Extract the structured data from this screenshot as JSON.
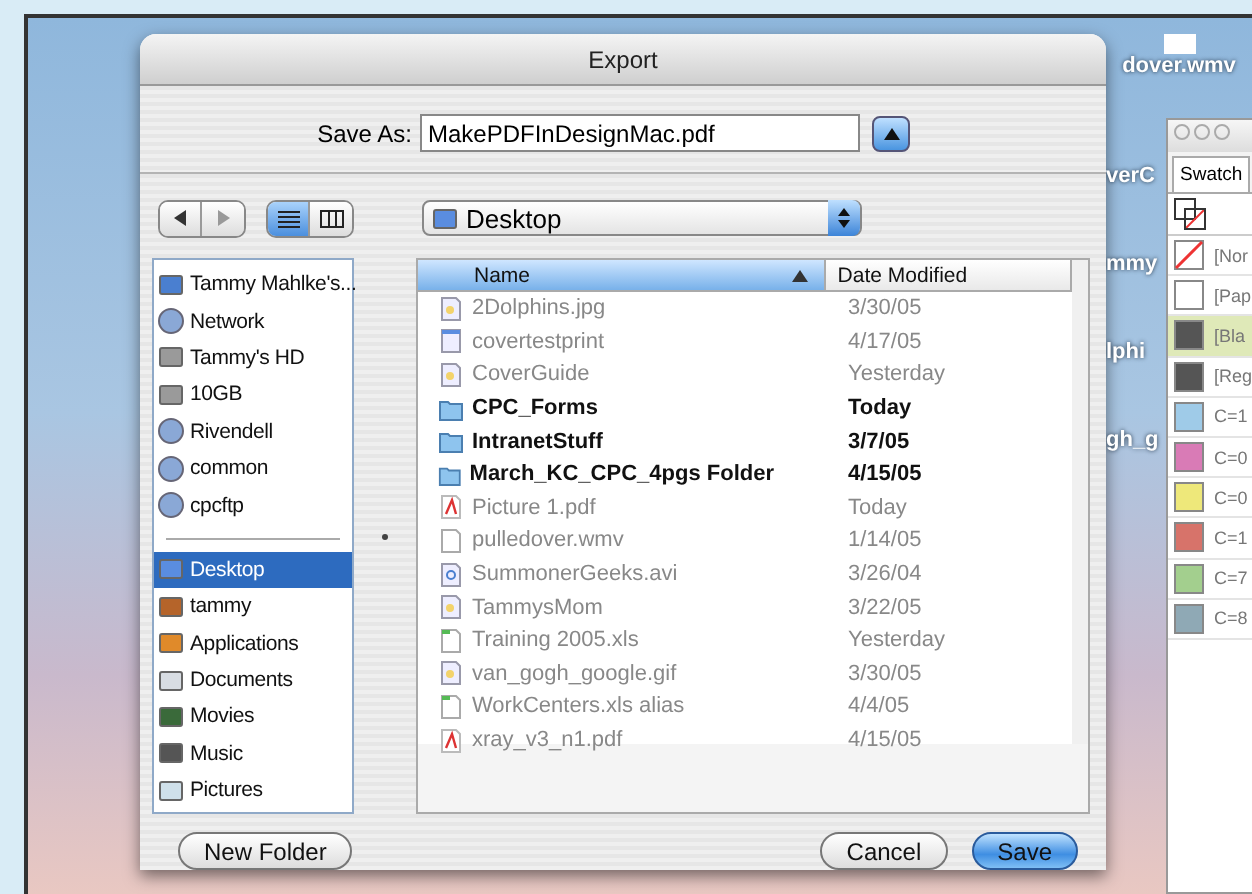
{
  "dialog": {
    "title": "Export",
    "save_as": {
      "label": "Save As:",
      "value": "MakePDFInDesignMac.pdf",
      "expanded": false
    },
    "view_buttons": [
      {
        "kind": "list",
        "selected": true
      },
      {
        "kind": "columns",
        "selected": false
      }
    ],
    "location": {
      "label": "Desktop"
    },
    "sidebar": {
      "volumes": [
        {
          "label": "Tammy Mahlke's...",
          "kind": "computer",
          "selected": false
        },
        {
          "label": "Network",
          "kind": "globe",
          "selected": false
        },
        {
          "label": "Tammy's HD",
          "kind": "disk",
          "selected": false
        },
        {
          "label": "10GB",
          "kind": "disk",
          "selected": false
        },
        {
          "label": "Rivendell",
          "kind": "globe",
          "selected": false
        },
        {
          "label": "common",
          "kind": "globe",
          "selected": false
        },
        {
          "label": "cpcftp",
          "kind": "globe",
          "selected": false
        }
      ],
      "places": [
        {
          "label": "Desktop",
          "kind": "desktop",
          "selected": true
        },
        {
          "label": "tammy",
          "kind": "home",
          "selected": false
        },
        {
          "label": "Applications",
          "kind": "apps",
          "selected": false
        },
        {
          "label": "Documents",
          "kind": "document",
          "selected": false
        },
        {
          "label": "Movies",
          "kind": "movie",
          "selected": false
        },
        {
          "label": "Music",
          "kind": "music",
          "selected": false
        },
        {
          "label": "Pictures",
          "kind": "picture",
          "selected": false
        }
      ]
    },
    "table": {
      "columns": [
        {
          "label": "Name",
          "selected": true
        },
        {
          "label": "Date Modified",
          "selected": false
        }
      ],
      "rows": [
        {
          "name": "2Dolphins.jpg",
          "date": "3/30/05",
          "kind": "image",
          "disabled": true
        },
        {
          "name": "covertestprint",
          "date": "4/17/05",
          "kind": "document",
          "disabled": true
        },
        {
          "name": "CoverGuide",
          "date": "Yesterday",
          "kind": "image",
          "disabled": true
        },
        {
          "name": "CPC_Forms",
          "date": "Today",
          "kind": "folder",
          "disabled": false
        },
        {
          "name": "IntranetStuff",
          "date": "3/7/05",
          "kind": "folder",
          "disabled": false
        },
        {
          "name": "March_KC_CPC_4pgs Folder",
          "date": "4/15/05",
          "kind": "folder",
          "disabled": false
        },
        {
          "name": "Picture 1.pdf",
          "date": "Today",
          "kind": "pdf",
          "disabled": true
        },
        {
          "name": "pulledover.wmv",
          "date": "1/14/05",
          "kind": "blank",
          "disabled": true
        },
        {
          "name": "SummonerGeeks.avi",
          "date": "3/26/04",
          "kind": "movie",
          "disabled": true
        },
        {
          "name": "TammysMom",
          "date": "3/22/05",
          "kind": "image",
          "disabled": true
        },
        {
          "name": "Training 2005.xls",
          "date": "Yesterday",
          "kind": "sheet",
          "disabled": true
        },
        {
          "name": "van_gogh_google.gif",
          "date": "3/30/05",
          "kind": "image",
          "disabled": true
        },
        {
          "name": "WorkCenters.xls alias",
          "date": "4/4/05",
          "kind": "sheet",
          "disabled": true
        },
        {
          "name": "xray_v3_n1.pdf",
          "date": "4/15/05",
          "kind": "pdf",
          "disabled": true
        }
      ]
    },
    "buttons": [
      {
        "label": "New Folder",
        "kind": "plain"
      },
      {
        "label": "Cancel",
        "kind": "plain"
      },
      {
        "label": "Save",
        "kind": "default"
      }
    ]
  },
  "desktop_icons": [
    {
      "label": "dover.wmv"
    },
    {
      "label": "verC"
    },
    {
      "label": "mmy"
    },
    {
      "label": "lphi"
    },
    {
      "label": "gh_g"
    }
  ],
  "swatches_panel": {
    "tab": "Swatch",
    "swatches": [
      {
        "label": "[Nor",
        "kind": "none",
        "selected": false
      },
      {
        "label": "[Pap",
        "color": "#ffffff",
        "kind": "solid",
        "selected": false
      },
      {
        "label": "[Bla",
        "color": "#555555",
        "kind": "solid",
        "selected": true
      },
      {
        "label": "[Reg",
        "color": "#555555",
        "kind": "solid",
        "selected": false
      },
      {
        "label": "C=1",
        "color": "#9fcbe8",
        "kind": "solid",
        "selected": false
      },
      {
        "label": "C=0",
        "color": "#d97bb6",
        "kind": "solid",
        "selected": false
      },
      {
        "label": "C=0",
        "color": "#eee87a",
        "kind": "solid",
        "selected": false
      },
      {
        "label": "C=1",
        "color": "#d7736a",
        "kind": "solid",
        "selected": false
      },
      {
        "label": "C=7",
        "color": "#a3cf8e",
        "kind": "solid",
        "selected": false
      },
      {
        "label": "C=8",
        "color": "#8fa9b5",
        "kind": "solid",
        "selected": false
      }
    ]
  }
}
